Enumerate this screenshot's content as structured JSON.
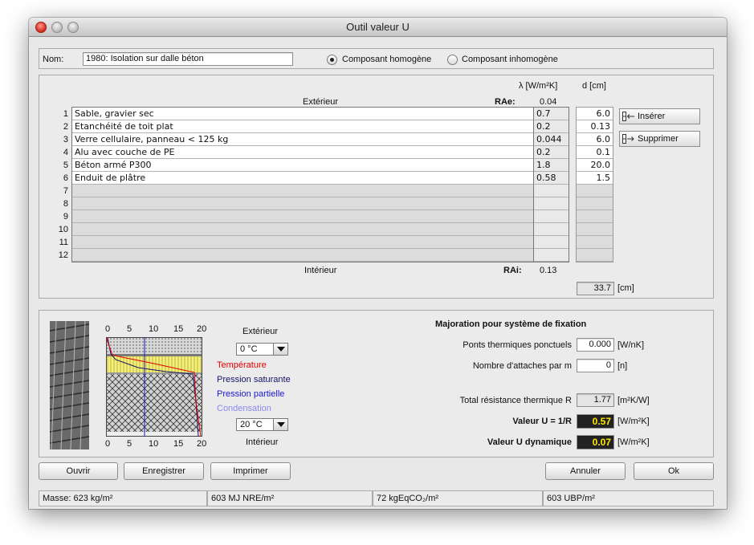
{
  "window": {
    "title": "Outil valeur U"
  },
  "name_row": {
    "label": "Nom:",
    "value": "1980: Isolation sur dalle béton",
    "radio_homogeneous": "Composant homogène",
    "radio_inhomogeneous": "Composant inhomogène",
    "selected": "homogeneous"
  },
  "layers": {
    "lambda_header": "λ [W/m²K]",
    "d_header": "d [cm]",
    "exterior_label": "Extérieur",
    "rae_label": "RAe:",
    "rae_value": "0.04",
    "interior_label": "Intérieur",
    "rai_label": "RAi:",
    "rai_value": "0.13",
    "total_thickness": "33.7",
    "total_unit": "[cm]",
    "rows": [
      {
        "n": "1",
        "material": "Sable, gravier sec",
        "lambda": "0.7",
        "d": "6.0"
      },
      {
        "n": "2",
        "material": "Etanchéité de toit plat",
        "lambda": "0.2",
        "d": "0.13"
      },
      {
        "n": "3",
        "material": "Verre cellulaire, panneau < 125 kg",
        "lambda": "0.044",
        "d": "6.0"
      },
      {
        "n": "4",
        "material": "Alu avec couche de PE",
        "lambda": "0.2",
        "d": "0.1"
      },
      {
        "n": "5",
        "material": "Béton armé P300",
        "lambda": "1.8",
        "d": "20.0"
      },
      {
        "n": "6",
        "material": "Enduit de plâtre",
        "lambda": "0.58",
        "d": "1.5"
      },
      {
        "n": "7",
        "material": "",
        "lambda": "",
        "d": ""
      },
      {
        "n": "8",
        "material": "",
        "lambda": "",
        "d": ""
      },
      {
        "n": "9",
        "material": "",
        "lambda": "",
        "d": ""
      },
      {
        "n": "10",
        "material": "",
        "lambda": "",
        "d": ""
      },
      {
        "n": "11",
        "material": "",
        "lambda": "",
        "d": ""
      },
      {
        "n": "12",
        "material": "",
        "lambda": "",
        "d": ""
      }
    ],
    "insert_button": "Insérer",
    "delete_button": "Supprimer"
  },
  "diagram": {
    "top_ticks": [
      "0",
      "5",
      "10",
      "15",
      "20"
    ],
    "bottom_ticks": [
      "0",
      "5",
      "10",
      "15",
      "20"
    ],
    "exterior_label": "Extérieur",
    "exterior_temp": "0 °C",
    "interior_label": "Intérieur",
    "interior_temp": "20 °C",
    "legend": [
      {
        "label": "Température",
        "color": "#e00000"
      },
      {
        "label": "Pression saturante",
        "color": "#141466"
      },
      {
        "label": "Pression partielle",
        "color": "#1a1ad0"
      },
      {
        "label": "Condensation",
        "color": "#8a8aee"
      }
    ]
  },
  "fixation": {
    "title": "Majoration pour système de fixation",
    "ponts_label": "Ponts thermiques ponctuels",
    "ponts_value": "0.000",
    "ponts_unit": "[W/nK]",
    "attaches_label": "Nombre d'attaches par m",
    "attaches_value": "0",
    "attaches_unit": "[n]",
    "total_r_label": "Total résistance thermique R",
    "total_r_value": "1.77",
    "total_r_unit": "[m²K/W]",
    "u_label": "Valeur U = 1/R",
    "u_value": "0.57",
    "u_unit": "[W/m²K]",
    "u_dyn_label": "Valeur U dynamique",
    "u_dyn_value": "0.07",
    "u_dyn_unit": "[W/m²K]"
  },
  "buttons": {
    "open": "Ouvrir",
    "save": "Enregistrer",
    "print": "Imprimer",
    "cancel": "Annuler",
    "ok": "Ok"
  },
  "status": {
    "mass": "Masse: 623 kg/m²",
    "nre": "603 MJ NRE/m²",
    "co2": "72 kgEqCO₂/m²",
    "ubp": "603 UBP/m²"
  }
}
